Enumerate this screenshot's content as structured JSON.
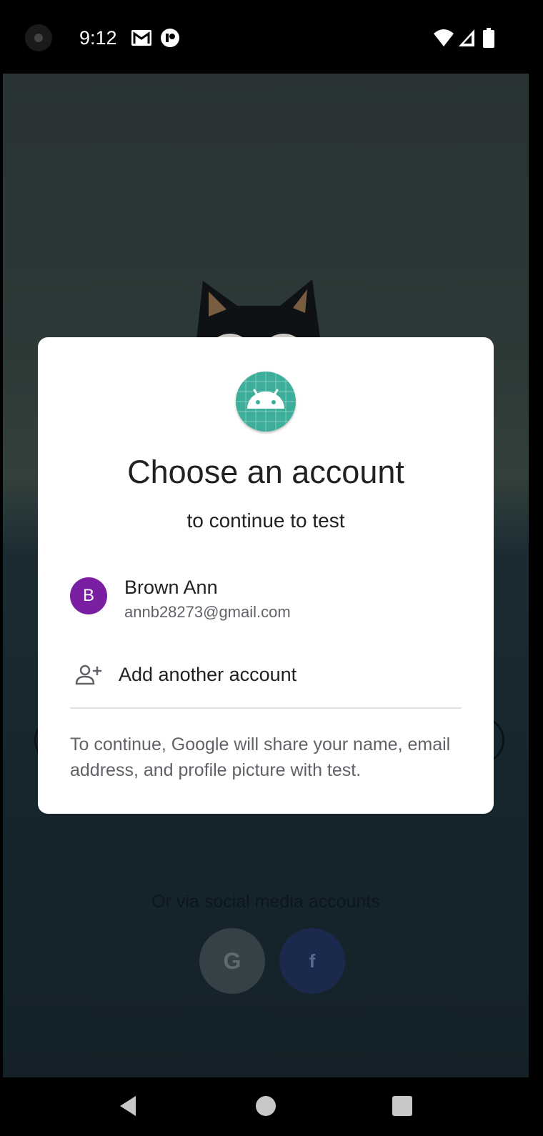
{
  "status_bar": {
    "time": "9:12",
    "left_icons": [
      "gmail-icon",
      "app-notification-icon"
    ],
    "right_icons": [
      "wifi-icon",
      "signal-icon",
      "battery-icon"
    ]
  },
  "background": {
    "social_prompt": "Or via social media accounts",
    "google_button_glyph": "G",
    "facebook_button_glyph": "f"
  },
  "dialog": {
    "app_icon": "android-icon",
    "title": "Choose an account",
    "subtitle": "to continue to test",
    "accounts": [
      {
        "initial": "B",
        "name": "Brown Ann",
        "email": "annb28273@gmail.com",
        "avatar_color": "#7b1fa2"
      }
    ],
    "add_account_label": "Add another account",
    "disclaimer": "To continue, Google will share your name, email address, and profile picture with test."
  },
  "colors": {
    "accent_android": "#3dae9a",
    "avatar": "#7b1fa2",
    "text_primary": "#202124",
    "text_secondary": "#5f6368"
  },
  "nav_bar": {
    "buttons": [
      "back-icon",
      "home-icon",
      "recents-icon"
    ]
  }
}
